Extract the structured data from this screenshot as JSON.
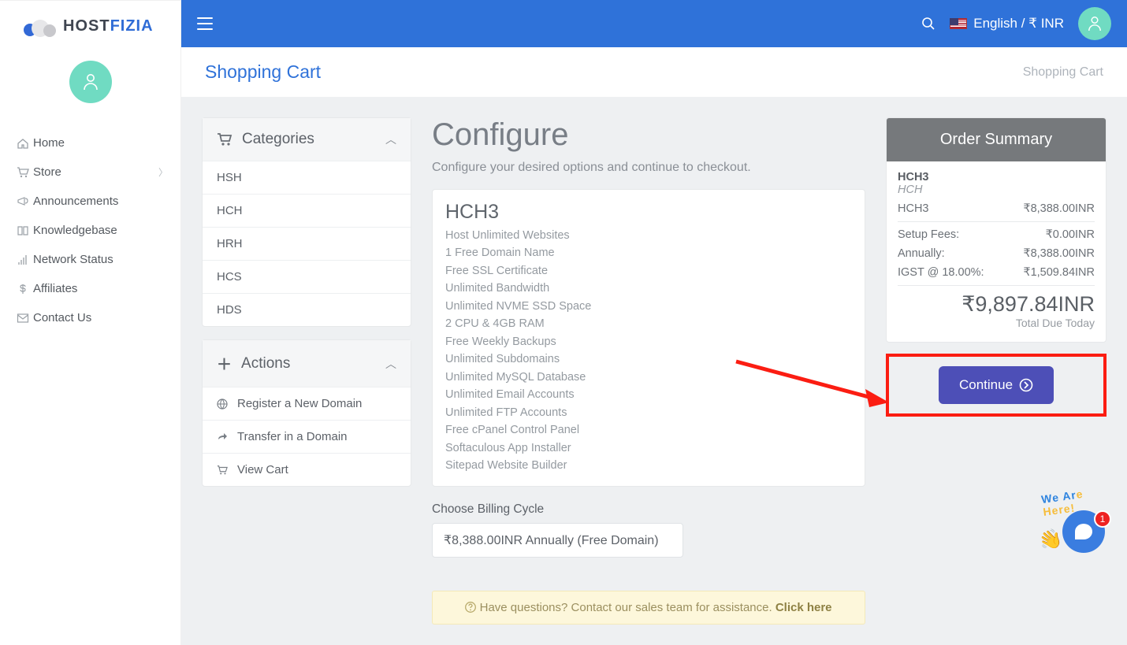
{
  "brand": {
    "part1": "HOST",
    "part2": "FIZIA"
  },
  "topbar": {
    "language": "English",
    "currency": "₹ INR",
    "sep": " / "
  },
  "titlebar": {
    "title": "Shopping Cart",
    "breadcrumb": "Shopping Cart"
  },
  "sidebar": {
    "items": [
      {
        "label": "Home",
        "icon": "home"
      },
      {
        "label": "Store",
        "icon": "cart",
        "hasSub": true
      },
      {
        "label": "Announcements",
        "icon": "mega"
      },
      {
        "label": "Knowledgebase",
        "icon": "book"
      },
      {
        "label": "Network Status",
        "icon": "signal"
      },
      {
        "label": "Affiliates",
        "icon": "dollar"
      },
      {
        "label": "Contact Us",
        "icon": "mail"
      }
    ]
  },
  "categories": {
    "title": "Categories",
    "items": [
      {
        "label": "HSH"
      },
      {
        "label": "HCH"
      },
      {
        "label": "HRH"
      },
      {
        "label": "HCS"
      },
      {
        "label": "HDS"
      }
    ]
  },
  "actions": {
    "title": "Actions",
    "items": [
      {
        "label": "Register a New Domain",
        "icon": "globe"
      },
      {
        "label": "Transfer in a Domain",
        "icon": "share"
      },
      {
        "label": "View Cart",
        "icon": "cart"
      }
    ]
  },
  "configure": {
    "heading": "Configure",
    "subheading": "Configure your desired options and continue to checkout.",
    "product": "HCH3",
    "features": [
      "Host Unlimited Websites",
      "1 Free Domain Name",
      "Free SSL Certificate",
      "Unlimited Bandwidth",
      "Unlimited NVME SSD Space",
      "2 CPU & 4GB RAM",
      "Free Weekly Backups",
      "Unlimited Subdomains",
      "Unlimited MySQL Database",
      "Unlimited Email Accounts",
      "Unlimited FTP Accounts",
      "Free cPanel Control Panel",
      "Softaculous App Installer",
      "Sitepad Website Builder"
    ],
    "billing_label": "Choose Billing Cycle",
    "billing_value": "₹8,388.00INR Annually (Free Domain)"
  },
  "summary": {
    "title": "Order Summary",
    "product": "HCH3",
    "category": "HCH",
    "lines": [
      {
        "label": "HCH3",
        "value": "₹8,388.00INR"
      },
      {
        "label": "Setup Fees:",
        "value": "₹0.00INR"
      },
      {
        "label": "Annually:",
        "value": "₹8,388.00INR"
      },
      {
        "label": "IGST @ 18.00%:",
        "value": "₹1,509.84INR"
      }
    ],
    "total": "₹9,897.84INR",
    "total_label": "Total Due Today",
    "continue": "Continue"
  },
  "alert": {
    "q": " Have questions? Contact our sales team for assistance. ",
    "link": "Click here"
  },
  "chat": {
    "badge": "1",
    "text": "We Are Here!"
  }
}
